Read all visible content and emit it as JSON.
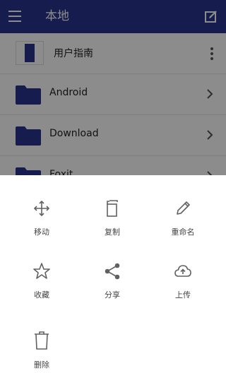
{
  "header": {
    "title": "本地"
  },
  "files": [
    {
      "name": "用户指南",
      "type": "document"
    },
    {
      "name": "Android",
      "type": "folder"
    },
    {
      "name": "Download",
      "type": "folder"
    },
    {
      "name": "Foxit",
      "type": "folder"
    }
  ],
  "actions": [
    {
      "label": "移动",
      "icon": "move-icon"
    },
    {
      "label": "复制",
      "icon": "copy-icon"
    },
    {
      "label": "重命名",
      "icon": "rename-pencil-icon"
    },
    {
      "label": "收藏",
      "icon": "star-icon"
    },
    {
      "label": "分享",
      "icon": "share-icon"
    },
    {
      "label": "上传",
      "icon": "cloud-upload-icon"
    },
    {
      "label": "删除",
      "icon": "trash-icon"
    }
  ],
  "colors": {
    "primary": "#2b348f",
    "icon": "#616161"
  }
}
